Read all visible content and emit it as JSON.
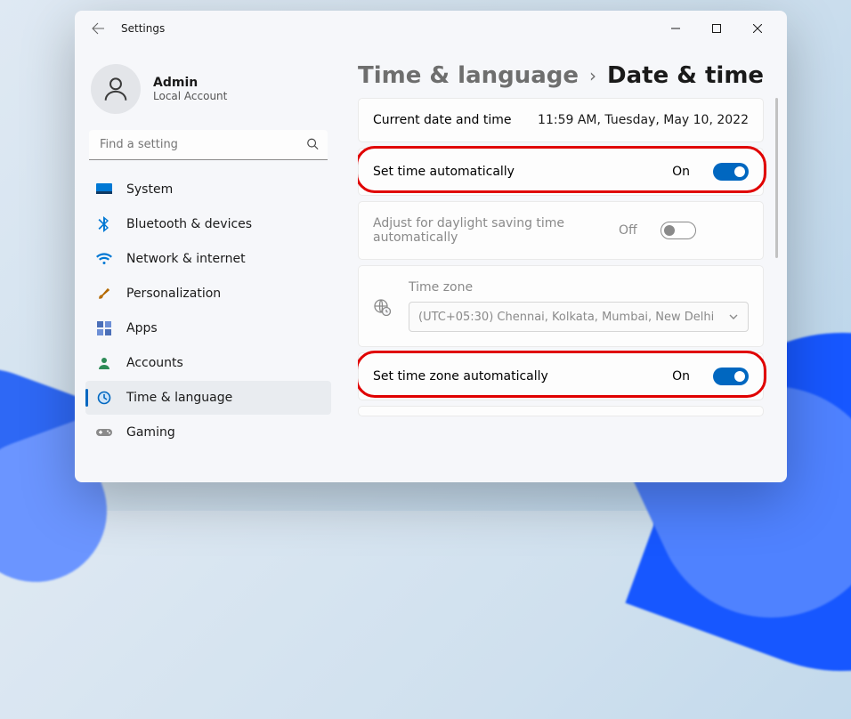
{
  "window": {
    "title": "Settings"
  },
  "user": {
    "name": "Admin",
    "account_type": "Local Account"
  },
  "search": {
    "placeholder": "Find a setting"
  },
  "sidebar": {
    "items": [
      {
        "label": "System"
      },
      {
        "label": "Bluetooth & devices"
      },
      {
        "label": "Network & internet"
      },
      {
        "label": "Personalization"
      },
      {
        "label": "Apps"
      },
      {
        "label": "Accounts"
      },
      {
        "label": "Time & language"
      },
      {
        "label": "Gaming"
      }
    ],
    "selected_index": 6
  },
  "breadcrumb": {
    "parent": "Time & language",
    "current": "Date & time"
  },
  "cards": {
    "current": {
      "label": "Current date and time",
      "value": "11:59 AM, Tuesday, May 10, 2022"
    },
    "set_time_auto": {
      "label": "Set time automatically",
      "state_text": "On",
      "on": true
    },
    "dst_auto": {
      "label": "Adjust for daylight saving time automatically",
      "state_text": "Off",
      "on": false
    },
    "time_zone": {
      "title": "Time zone",
      "selected": "(UTC+05:30) Chennai, Kolkata, Mumbai, New Delhi"
    },
    "set_tz_auto": {
      "label": "Set time zone automatically",
      "state_text": "On",
      "on": true
    }
  }
}
